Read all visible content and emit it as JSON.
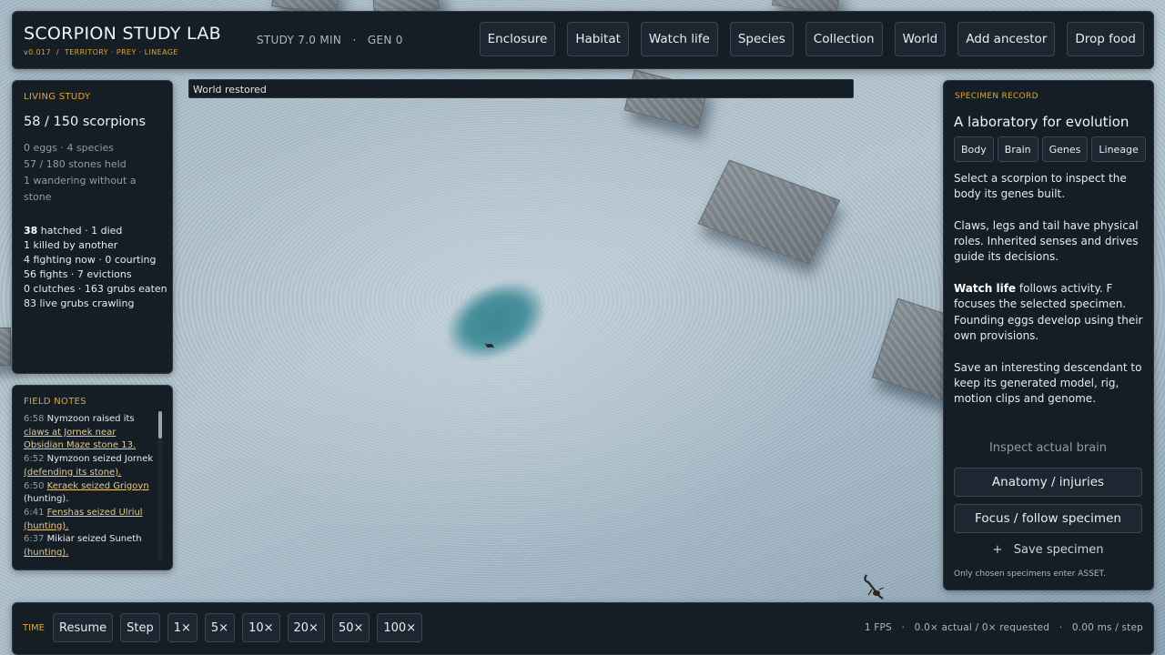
{
  "header": {
    "title": "SCORPION STUDY LAB",
    "subtitle": "v0.017  /  TERRITORY · PREY · LINEAGE",
    "stats": "STUDY 7.0 MIN   ·   GEN 0",
    "nav": [
      "Enclosure",
      "Habitat",
      "Watch life",
      "Species",
      "Collection",
      "World",
      "Add ancestor",
      "Drop food"
    ]
  },
  "toast": "World restored",
  "living_study": {
    "title": "LIVING STUDY",
    "count": "58 / 150 scorpions",
    "line1": "0 eggs · 4 species",
    "line2": "57 / 180 stones held",
    "line3": "1 wandering without a stone",
    "hatched_num": "38",
    "hatched_rest": " hatched · 1 died",
    "s2": "1 killed by another",
    "s3": "4 fighting now · 0 courting",
    "s4": "56 fights · 7 evictions",
    "s5": "0 clutches · 163 grubs eaten",
    "s6": "83 live grubs crawling"
  },
  "field_notes": {
    "title": "FIELD NOTES",
    "entries": [
      {
        "time": "6:58",
        "plain": "Nymzoon raised its ",
        "link": "claws at Jornek near Obsidian Maze stone 13."
      },
      {
        "time": "6:52",
        "plain": "Nymzoon seized Jornek ",
        "link": "(defending its stone)."
      },
      {
        "time": "6:50",
        "plain": "",
        "link": "Keraek seized Grigoyn",
        "tail": " (hunting)."
      },
      {
        "time": "6:41",
        "plain": "",
        "link": "Fenshas seized Ulriul (hunting)."
      },
      {
        "time": "6:37",
        "plain": "Mikiar seized Suneth ",
        "link": "(hunting)."
      }
    ]
  },
  "specimen": {
    "label": "SPECIMEN RECORD",
    "title": "A laboratory for evolution",
    "tabs": [
      "Body",
      "Brain",
      "Genes",
      "Lineage"
    ],
    "p1": "Select a scorpion to inspect the body its genes built.",
    "p2": "Claws, legs and tail have physical roles. Inherited senses and drives guide its decisions.",
    "p3_bold": "Watch life",
    "p3_rest": " follows activity. F focuses the selected specimen. Founding eggs develop using their own provisions.",
    "p4": "Save an interesting descendant to keep its generated model, rig, motion clips and genome.",
    "inspect_brain": "Inspect actual brain",
    "anatomy": "Anatomy / injuries",
    "focus": "Focus / follow specimen",
    "save": "+   Save specimen",
    "note": "Only chosen specimens enter ASSET."
  },
  "time": {
    "label": "TIME",
    "buttons": [
      "Resume",
      "Step",
      "1×",
      "5×",
      "10×",
      "20×",
      "50×",
      "100×"
    ],
    "stats": "1 FPS   ·   0.0× actual / 0× requested   ·   0.00 ms / step"
  },
  "colors": {
    "accent": "#e0a43a",
    "panel": "#151d25",
    "water": "#3c8a96"
  },
  "icons": [
    "scorpion-icon",
    "plus-icon"
  ]
}
